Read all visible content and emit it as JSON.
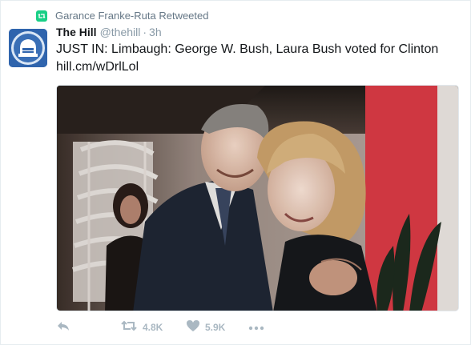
{
  "retweet_context": {
    "icon": "retweet-badge-icon",
    "text": "Garance Franke-Ruta Retweeted",
    "color": "#19cf86"
  },
  "author": {
    "avatar_icon": "the-hill-logo-icon",
    "name": "The Hill",
    "handle": "@thehill",
    "separator": "·",
    "time": "3h"
  },
  "tweet": {
    "text": "JUST IN: Limbaugh: George W. Bush, Laura Bush voted for Clinton",
    "link": "hill.cm/wDrlLol"
  },
  "media": {
    "type": "photo"
  },
  "actions": {
    "reply_icon": "reply-icon",
    "retweet_icon": "retweet-icon",
    "retweet_count": "4.8K",
    "like_icon": "heart-icon",
    "like_count": "5.9K",
    "more_icon": "more-icon",
    "icon_color": "#aab8c2"
  }
}
